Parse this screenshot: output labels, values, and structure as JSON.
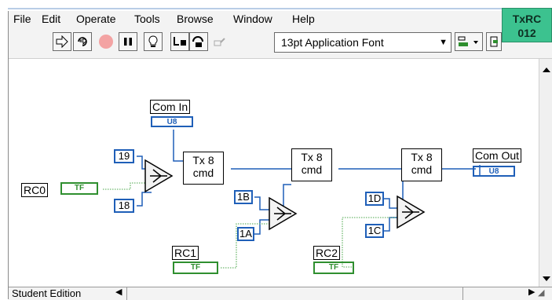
{
  "menu": {
    "file": "File",
    "edit": "Edit",
    "operate": "Operate",
    "tools": "Tools",
    "browse": "Browse",
    "window": "Window",
    "help": "Help"
  },
  "toolbar": {
    "font": "13pt Application Font"
  },
  "vi_icon": {
    "line1": "TxRC",
    "line2": "012"
  },
  "diagram": {
    "com_in_label": "Com In",
    "com_out_label": "Com Out",
    "u8_text": "U8",
    "tf_text": "TF",
    "rc0": "RC0",
    "rc1": "RC1",
    "rc2": "RC2",
    "tx_line1": "Tx 8",
    "tx_line2": "cmd",
    "c19": "19",
    "c18": "18",
    "c1b": "1B",
    "c1a": "1A",
    "c1d": "1D",
    "c1c": "1C"
  },
  "status": {
    "edition": "Student Edition"
  },
  "colors": {
    "u8_wire": "#1f5fb8",
    "bool_wire": "#2f8f2f",
    "vi_icon": "#3cc28f"
  }
}
